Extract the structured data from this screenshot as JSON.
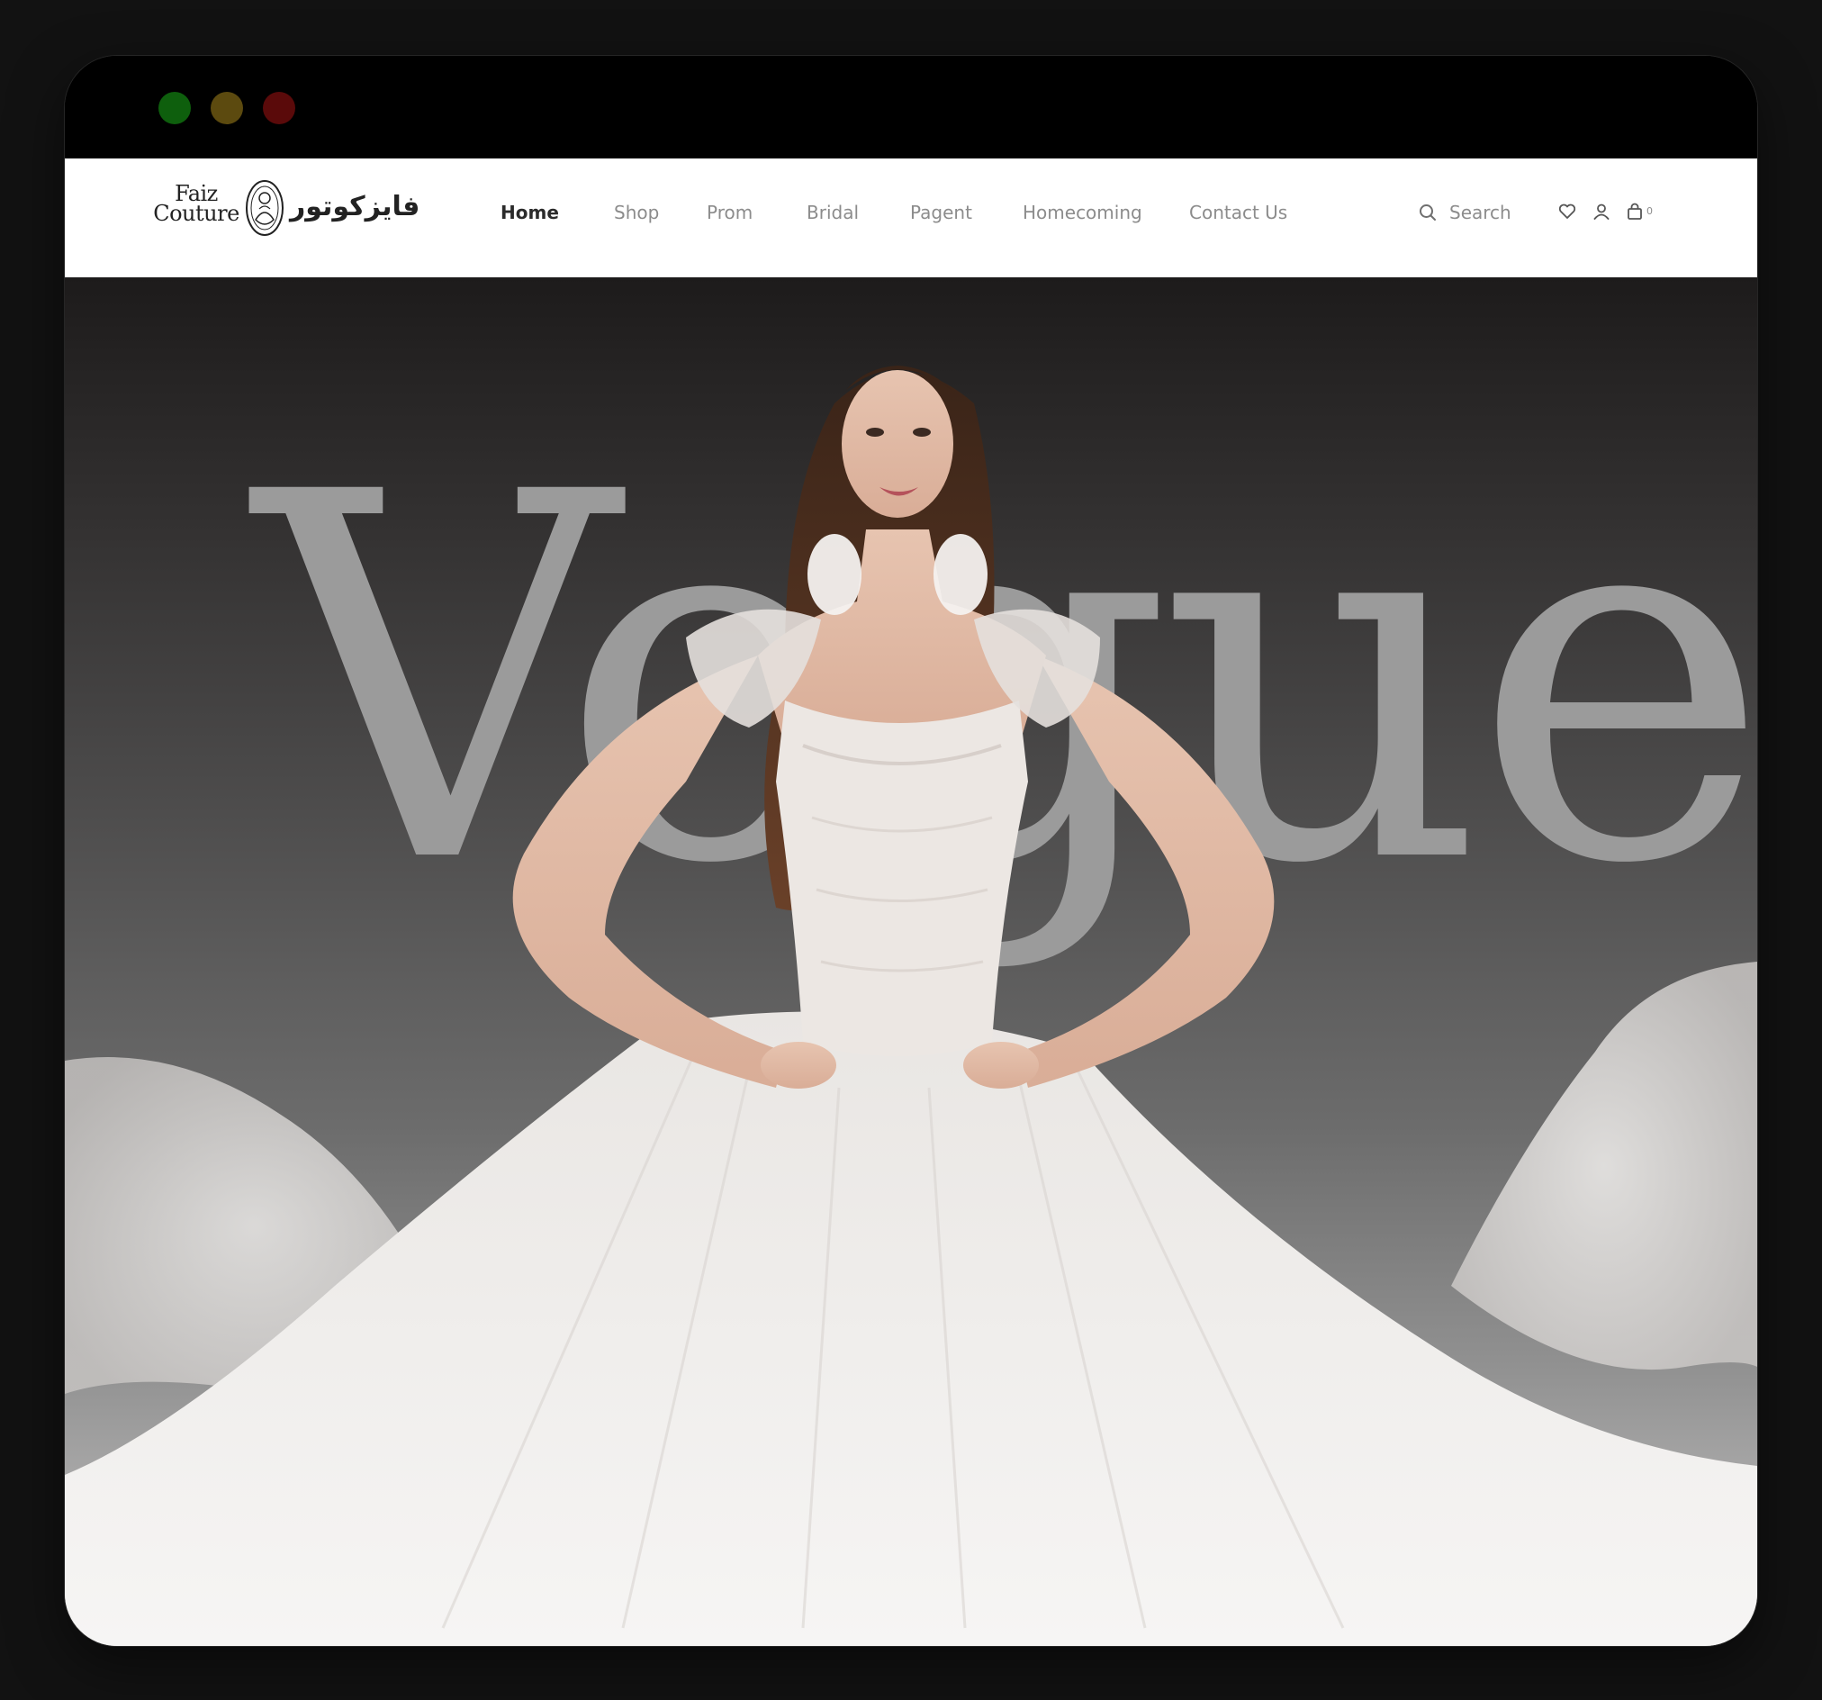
{
  "window": {
    "controls": [
      "green",
      "yellow",
      "red"
    ]
  },
  "brand": {
    "latin_line1": "Faiz",
    "latin_line2": "Couture",
    "arabic": "فايزكوتور"
  },
  "nav": {
    "items": [
      {
        "label": "Home",
        "active": true
      },
      {
        "label": "Shop"
      },
      {
        "label": "Prom"
      },
      {
        "label": "Bridal"
      },
      {
        "label": "Pagent"
      },
      {
        "label": "Homecoming"
      },
      {
        "label": "Contact Us"
      }
    ]
  },
  "search": {
    "label": "Search",
    "icon": "search-icon"
  },
  "actions": {
    "icons": [
      "heart-icon",
      "user-icon",
      "bag-icon"
    ],
    "cart_count": "0"
  },
  "hero": {
    "headline": "Vogue",
    "image": "model-in-white-tulle-gown"
  },
  "colors": {
    "page_bg": "#121212",
    "nav_bg": "#ffffff",
    "nav_active": "#2b2b2b",
    "nav_inactive": "#8c8c8c",
    "headline": "#9b9b9b"
  }
}
